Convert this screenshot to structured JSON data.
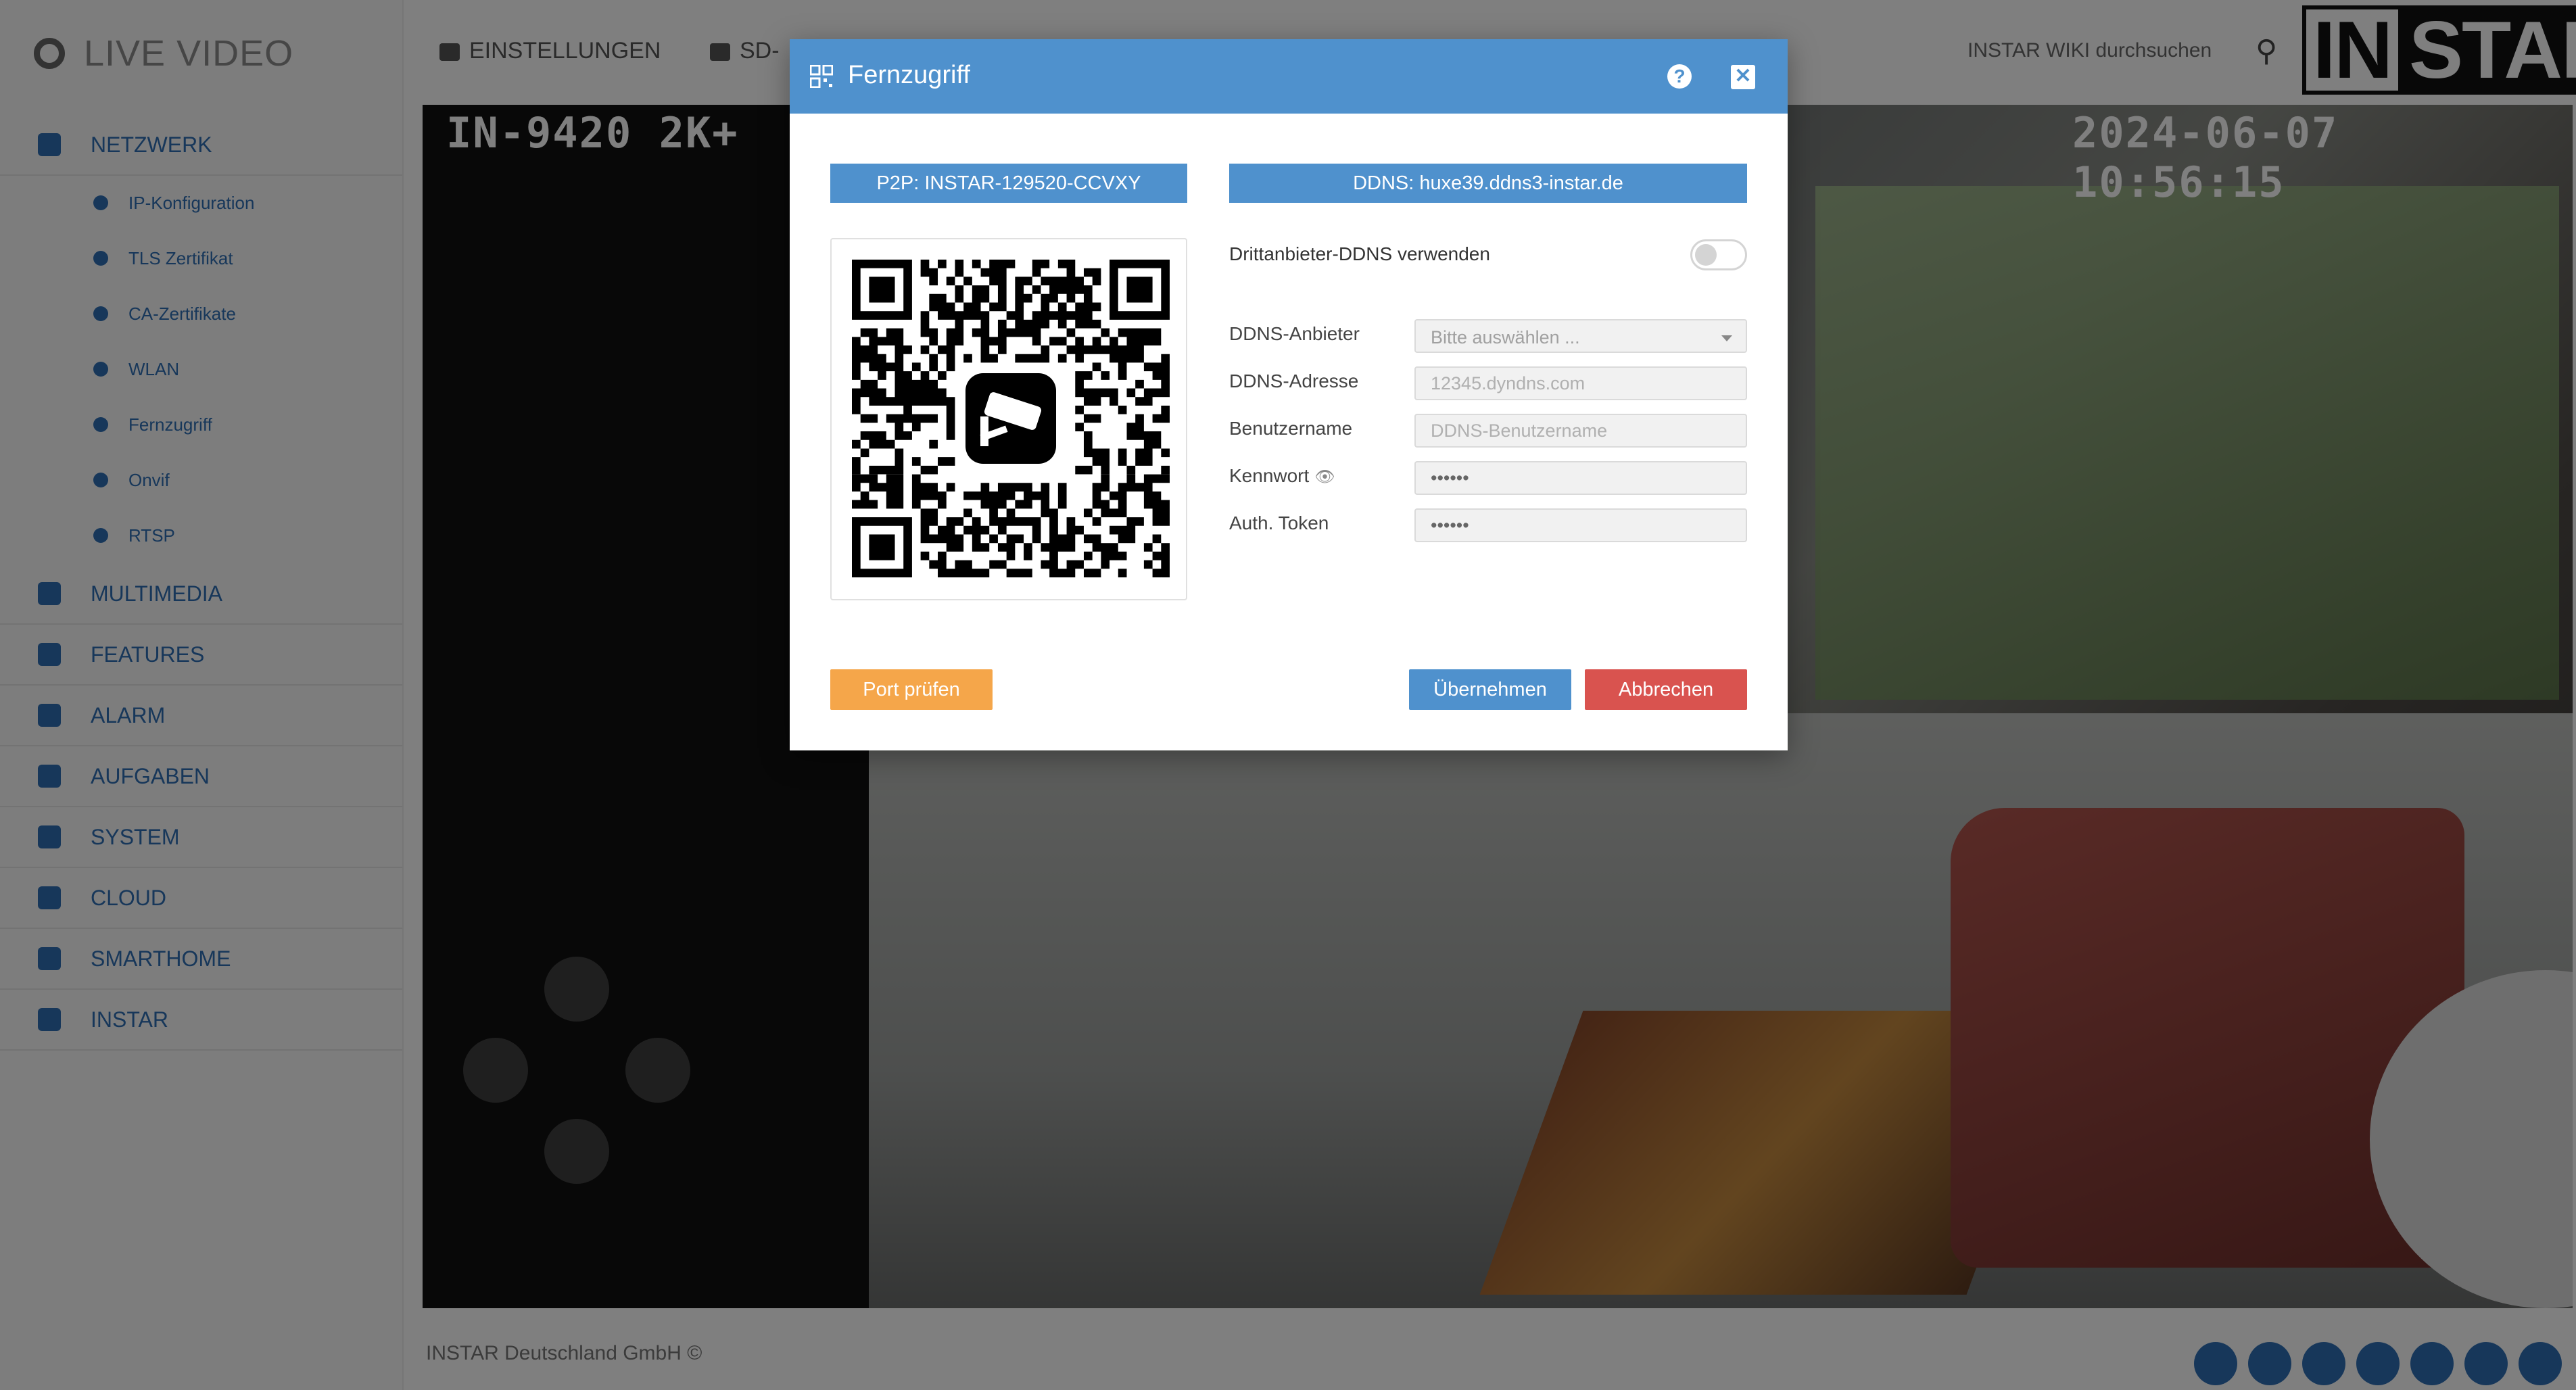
{
  "app": {
    "title": "LIVE VIDEO",
    "tabs": [
      "EINSTELLUNGEN",
      "SD-"
    ],
    "search_placeholder": "INSTAR WIKI durchsuchen",
    "logo_text_in": "IN",
    "logo_text_star": "STAR",
    "footer": "INSTAR Deutschland GmbH ©"
  },
  "sidebar": {
    "sections": [
      {
        "label": "NETZWERK",
        "icon": "network-icon"
      },
      {
        "label": "MULTIMEDIA",
        "icon": "image-icon"
      },
      {
        "label": "FEATURES",
        "icon": "features-icon"
      },
      {
        "label": "ALARM",
        "icon": "bell-icon"
      },
      {
        "label": "AUFGABEN",
        "icon": "calendar-icon"
      },
      {
        "label": "SYSTEM",
        "icon": "gear-icon"
      },
      {
        "label": "CLOUD",
        "icon": "cloud-icon"
      },
      {
        "label": "SMARTHOME",
        "icon": "smarthome-icon"
      },
      {
        "label": "INSTAR",
        "icon": "instar-icon"
      }
    ],
    "netzwerk_items": [
      "IP-Konfiguration",
      "TLS Zertifikat",
      "CA-Zertifikate",
      "WLAN",
      "Fernzugriff",
      "Onvif",
      "RTSP"
    ]
  },
  "video": {
    "osd_model": "IN-9420 2K+",
    "osd_timestamp": "2024-06-07 10:56:15"
  },
  "modal": {
    "title": "Fernzugriff",
    "p2p_label": "P2P: INSTAR-129520-CCVXY",
    "ddns_label": "DDNS: huxe39.ddns3-instar.de",
    "toggle_label": "Drittanbieter-DDNS verwenden",
    "toggle_on": false,
    "fields": {
      "provider_label": "DDNS-Anbieter",
      "provider_value": "Bitte auswählen ...",
      "address_label": "DDNS-Adresse",
      "address_placeholder": "12345.dyndns.com",
      "username_label": "Benutzername",
      "username_placeholder": "DDNS-Benutzername",
      "password_label": "Kennwort",
      "password_value": "••••••",
      "token_label": "Auth. Token",
      "token_value": "••••••"
    },
    "buttons": {
      "port_check": "Port prüfen",
      "apply": "Übernehmen",
      "cancel": "Abbrechen"
    }
  },
  "colors": {
    "accent": "#4f91cd",
    "warning": "#f5a64a",
    "danger": "#d9534f"
  }
}
